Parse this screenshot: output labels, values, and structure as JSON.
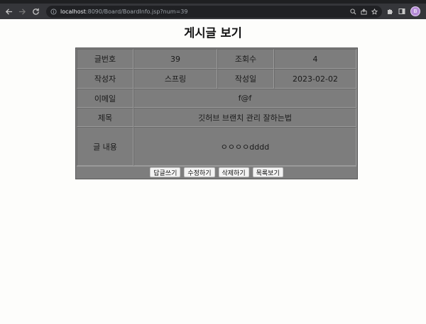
{
  "browser": {
    "url_host": "localhost",
    "url_rest": ":8090/Board/BoardInfo.jsp?num=39",
    "avatar_letter": "B"
  },
  "page": {
    "title": "게시글 보기"
  },
  "post": {
    "num_label": "글번호",
    "num_value": "39",
    "views_label": "조회수",
    "views_value": "4",
    "author_label": "작성자",
    "author_value": "스프링",
    "date_label": "작성일",
    "date_value": "2023-02-02",
    "email_label": "이메일",
    "email_value": "f@f",
    "subject_label": "제목",
    "subject_value": "깃허브 브랜치 관리 잘하는법",
    "content_label": "글 내용",
    "content_value": "ㅇㅇㅇㅇdddd"
  },
  "buttons": {
    "reply": "답글쓰기",
    "edit": "수정하기",
    "delete": "삭제하기",
    "list": "목록보기"
  }
}
